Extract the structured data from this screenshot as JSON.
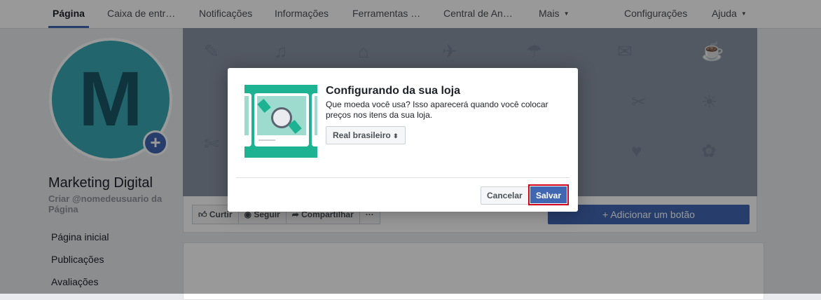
{
  "nav": {
    "items": [
      "Página",
      "Caixa de entr…",
      "Notificações",
      "Informações",
      "Ferramentas …",
      "Central de An…",
      "Mais"
    ],
    "right": [
      "Configurações",
      "Ajuda"
    ]
  },
  "profile": {
    "avatar_letter": "M",
    "name": "Marketing Digital",
    "username_prompt": "Criar @nomedeusuario da Página"
  },
  "sidebar": {
    "items": [
      "Página inicial",
      "Publicações",
      "Avaliações"
    ]
  },
  "action_bar": {
    "like": "Curtir",
    "follow": "Seguir",
    "share": "Compartilhar",
    "more": "···",
    "add_button": "+ Adicionar um botão"
  },
  "dialog": {
    "title": "Configurando da sua loja",
    "text": "Que moeda você usa? Isso aparecerá quando você colocar preços nos itens da sua loja.",
    "currency": "Real brasileiro",
    "cancel": "Cancelar",
    "save": "Salvar"
  },
  "colors": {
    "brand": "#4267b2",
    "highlight": "#d0021b",
    "illustration": "#1db291"
  }
}
